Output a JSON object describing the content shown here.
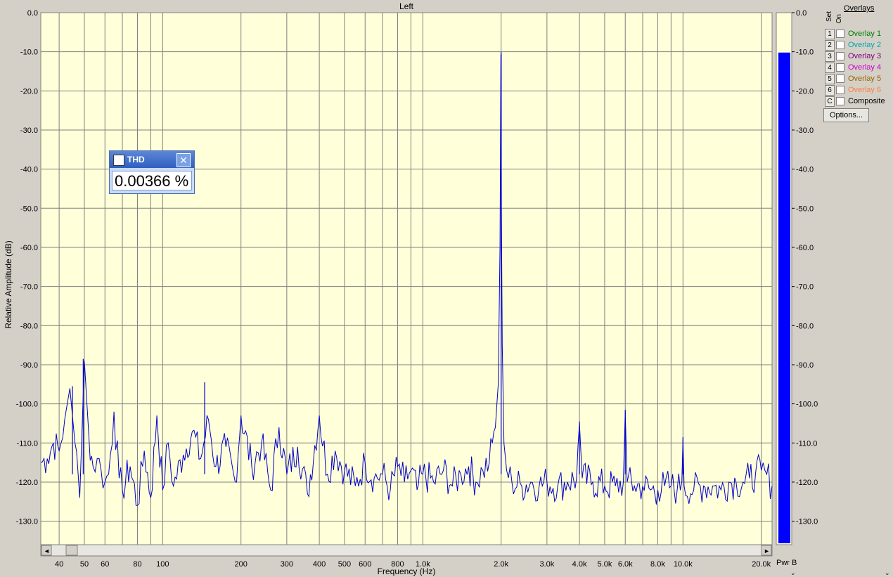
{
  "chart_data": {
    "type": "line",
    "title": "Left",
    "xlabel": "Frequency (Hz)",
    "ylabel": "Relative Amplitude (dB)",
    "x_scale": "log",
    "xlim": [
      34,
      22000
    ],
    "ylim": [
      -136,
      0
    ],
    "y_ticks": [
      "0.0",
      "-10.0",
      "-20.0",
      "-30.0",
      "-40.0",
      "-50.0",
      "-60.0",
      "-70.0",
      "-80.0",
      "-90.0",
      "-100.0",
      "-110.0",
      "-120.0",
      "-130.0"
    ],
    "y_tick_values": [
      0,
      -10,
      -20,
      -30,
      -40,
      -50,
      -60,
      -70,
      -80,
      -90,
      -100,
      -110,
      -120,
      -130
    ],
    "x_ticks": [
      {
        "v": 40,
        "label": "40"
      },
      {
        "v": 50,
        "label": "50"
      },
      {
        "v": 60,
        "label": "60"
      },
      {
        "v": 80,
        "label": "80"
      },
      {
        "v": 100,
        "label": "100"
      },
      {
        "v": 200,
        "label": "200"
      },
      {
        "v": 300,
        "label": "300"
      },
      {
        "v": 400,
        "label": "400"
      },
      {
        "v": 500,
        "label": "500"
      },
      {
        "v": 600,
        "label": "600"
      },
      {
        "v": 800,
        "label": "800"
      },
      {
        "v": 1000,
        "label": "1.0k"
      },
      {
        "v": 2000,
        "label": "2.0k"
      },
      {
        "v": 3000,
        "label": "3.0k"
      },
      {
        "v": 4000,
        "label": "4.0k"
      },
      {
        "v": 5000,
        "label": "5.0k"
      },
      {
        "v": 6000,
        "label": "6.0k"
      },
      {
        "v": 8000,
        "label": "8.0k"
      },
      {
        "v": 10000,
        "label": "10.0k"
      },
      {
        "v": 20000,
        "label": "20.0k"
      }
    ],
    "grid_minor_x": [
      70,
      90,
      700,
      900,
      7000,
      9000
    ],
    "grid": true,
    "series": [
      {
        "color": "#0000cc",
        "x": [
          34,
          36,
          38,
          40,
          42,
          44,
          46,
          48,
          50,
          52,
          54,
          56,
          58,
          60,
          62,
          65,
          68,
          70,
          75,
          80,
          85,
          90,
          95,
          100,
          105,
          110,
          120,
          130,
          140,
          150,
          160,
          175,
          190,
          200,
          220,
          240,
          260,
          280,
          300,
          330,
          360,
          400,
          430,
          460,
          500,
          550,
          600,
          650,
          700,
          750,
          800,
          850,
          900,
          950,
          1000,
          1100,
          1200,
          1300,
          1400,
          1500,
          1600,
          1700,
          1800,
          1850,
          1900,
          1950,
          1980,
          1995,
          2000,
          2005,
          2020,
          2050,
          2100,
          2200,
          2400,
          2600,
          2800,
          3000,
          3300,
          3600,
          3900,
          4000,
          4100,
          4500,
          5000,
          5500,
          5900,
          6000,
          6100,
          6500,
          7000,
          7500,
          8000,
          8500,
          9000,
          9500,
          9900,
          10000,
          10100,
          11000,
          12000,
          13000,
          14000,
          15000,
          16000,
          17000,
          18000,
          19000,
          20000,
          21000,
          22000
        ],
        "y": [
          -115,
          -114,
          -110,
          -112,
          -104,
          -96,
          -110,
          -124,
          -89,
          -108,
          -116,
          -114,
          -117,
          -120,
          -118,
          -102,
          -119,
          -122,
          -116,
          -126,
          -112,
          -124,
          -103,
          -122,
          -110,
          -121,
          -113,
          -107,
          -114,
          -104,
          -116,
          -111,
          -120,
          -103,
          -116,
          -110,
          -122,
          -106,
          -118,
          -111,
          -123,
          -103,
          -118,
          -112,
          -117,
          -121,
          -115,
          -119,
          -118,
          -122,
          -116,
          -120,
          -117,
          -122,
          -118,
          -120,
          -117,
          -121,
          -118,
          -116,
          -120,
          -117,
          -115,
          -110,
          -106,
          -95,
          -60,
          -11,
          -10,
          -50,
          -85,
          -110,
          -117,
          -120,
          -121,
          -120,
          -121,
          -120,
          -121,
          -120,
          -119,
          -105,
          -119,
          -120,
          -121,
          -121,
          -120,
          -102,
          -120,
          -121,
          -121,
          -122,
          -122,
          -121,
          -121,
          -122,
          -120,
          -109,
          -121,
          -122,
          -121,
          -121,
          -122,
          -120,
          -120,
          -120,
          -119,
          -118,
          -117,
          -118,
          -121
        ]
      }
    ],
    "peak_spikes": [
      {
        "x": 2000,
        "y": -10.5
      },
      {
        "x": 4000,
        "y": -104.5
      },
      {
        "x": 6000,
        "y": -101.5
      },
      {
        "x": 10000,
        "y": -108.5
      },
      {
        "x": 49.5,
        "y": -88.5
      },
      {
        "x": 45,
        "y": -95.5
      },
      {
        "x": 145,
        "y": -94.5
      }
    ]
  },
  "meter": {
    "label": "Pwr B",
    "level_db": -10.2,
    "ticks": [
      "0.0",
      "-10.0",
      "-20.0",
      "-30.0",
      "-40.0",
      "-50.0",
      "-60.0",
      "-70.0",
      "-80.0",
      "-90.0",
      "-100.0",
      "-110.0",
      "-120.0",
      "-130.0"
    ],
    "fill_color": "#0000ff"
  },
  "thd": {
    "title": "THD",
    "value": "0.00366 %",
    "close_glyph": "✕"
  },
  "overlays": {
    "heading": "Overlays",
    "set_label": "Set",
    "on_label": "On",
    "rows": [
      {
        "key": "1",
        "label": "Overlay 1",
        "color": "#008000"
      },
      {
        "key": "2",
        "label": "Overlay 2",
        "color": "#00aaaa"
      },
      {
        "key": "3",
        "label": "Overlay 3",
        "color": "#800080"
      },
      {
        "key": "4",
        "label": "Overlay 4",
        "color": "#cc00cc"
      },
      {
        "key": "5",
        "label": "Overlay 5",
        "color": "#996600"
      },
      {
        "key": "6",
        "label": "Overlay 6",
        "color": "#ff8040"
      },
      {
        "key": "C",
        "label": "Composite",
        "color": "#000000"
      }
    ],
    "options_label": "Options..."
  },
  "scrollbar": {
    "left_glyph": "◄",
    "right_glyph": "►"
  }
}
